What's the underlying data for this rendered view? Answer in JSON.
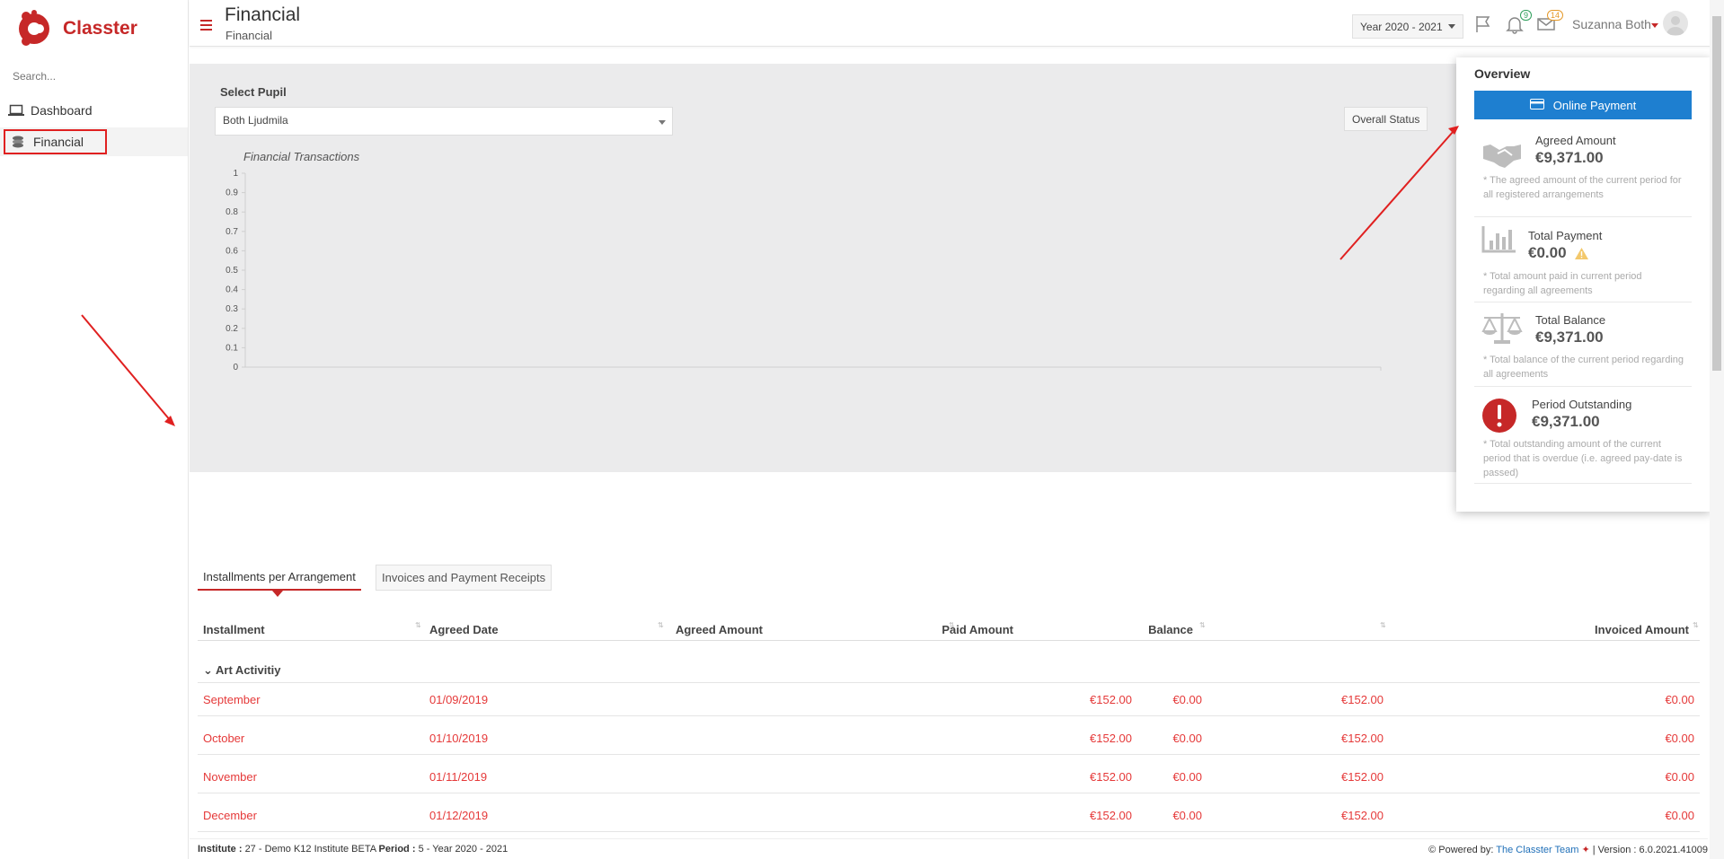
{
  "sidebar": {
    "brand": "Classter",
    "search_placeholder": "Search...",
    "items": [
      {
        "label": "Dashboard",
        "icon": "laptop-icon"
      },
      {
        "label": "Financial",
        "icon": "coins-icon",
        "active": true
      }
    ]
  },
  "header": {
    "title": "Financial",
    "subtitle": "Financial",
    "year": "Year 2020 - 2021",
    "notifications_count": "9",
    "messages_count": "14",
    "user_name": "Suzanna Both"
  },
  "panel": {
    "select_pupil_label": "Select Pupil",
    "pupil_value": "Both Ljudmila",
    "overall_status_label": "Overall Status",
    "chart_title": "Financial Transactions"
  },
  "chart_data": {
    "type": "bar",
    "title": "Financial Transactions",
    "categories": [],
    "series": [],
    "ylim": [
      0,
      1
    ],
    "yticks": [
      "1",
      "0.9",
      "0.8",
      "0.7",
      "0.6",
      "0.5",
      "0.4",
      "0.3",
      "0.2",
      "0.1",
      "0"
    ],
    "grid": false
  },
  "overview": {
    "title": "Overview",
    "online_payment_label": "Online Payment",
    "items": [
      {
        "name": "Agreed Amount",
        "amount": "€9,371.00",
        "note": "* The agreed amount of the current period for all registered arrangements",
        "icon": "handshake-icon"
      },
      {
        "name": "Total Payment",
        "amount": "€0.00",
        "note": "* Total amount paid in current period regarding all agreements",
        "icon": "bar-chart-icon"
      },
      {
        "name": "Total Balance",
        "amount": "€9,371.00",
        "note": "* Total balance of the current period regarding all agreements",
        "icon": "scale-icon"
      },
      {
        "name": "Period Outstanding",
        "amount": "€9,371.00",
        "note": "* Total outstanding amount of the current period that is overdue (i.e. agreed pay-date is passed)",
        "icon": "exclamation-icon"
      }
    ]
  },
  "tabs": [
    {
      "label": "Installments per Arrangement",
      "active": true
    },
    {
      "label": "Invoices and Payment Receipts",
      "active": false
    }
  ],
  "table": {
    "headers": [
      "Installment",
      "Agreed Date",
      "Agreed Amount",
      "Paid Amount",
      "Balance",
      "Invoiced Amount"
    ],
    "group": "Art Activitiy",
    "rows": [
      [
        "September",
        "01/09/2019",
        "€152.00",
        "€0.00",
        "€152.00",
        "€0.00"
      ],
      [
        "October",
        "01/10/2019",
        "€152.00",
        "€0.00",
        "€152.00",
        "€0.00"
      ],
      [
        "November",
        "01/11/2019",
        "€152.00",
        "€0.00",
        "€152.00",
        "€0.00"
      ],
      [
        "December",
        "01/12/2019",
        "€152.00",
        "€0.00",
        "€152.00",
        "€0.00"
      ]
    ]
  },
  "footer": {
    "institute_label": "Institute :",
    "institute_value": "27 - Demo K12 Institute BETA",
    "period_label": "Period :",
    "period_value": "5 - Year 2020 - 2021",
    "powered_label": "Powered by:",
    "powered_link": "The Classter Team",
    "version": "| Version : 6.0.2021.41009"
  },
  "colors": {
    "brand_red": "#c62828",
    "primary_blue": "#1e7fd0",
    "row_text_red": "#e53939",
    "annotation_red": "#e02020"
  }
}
